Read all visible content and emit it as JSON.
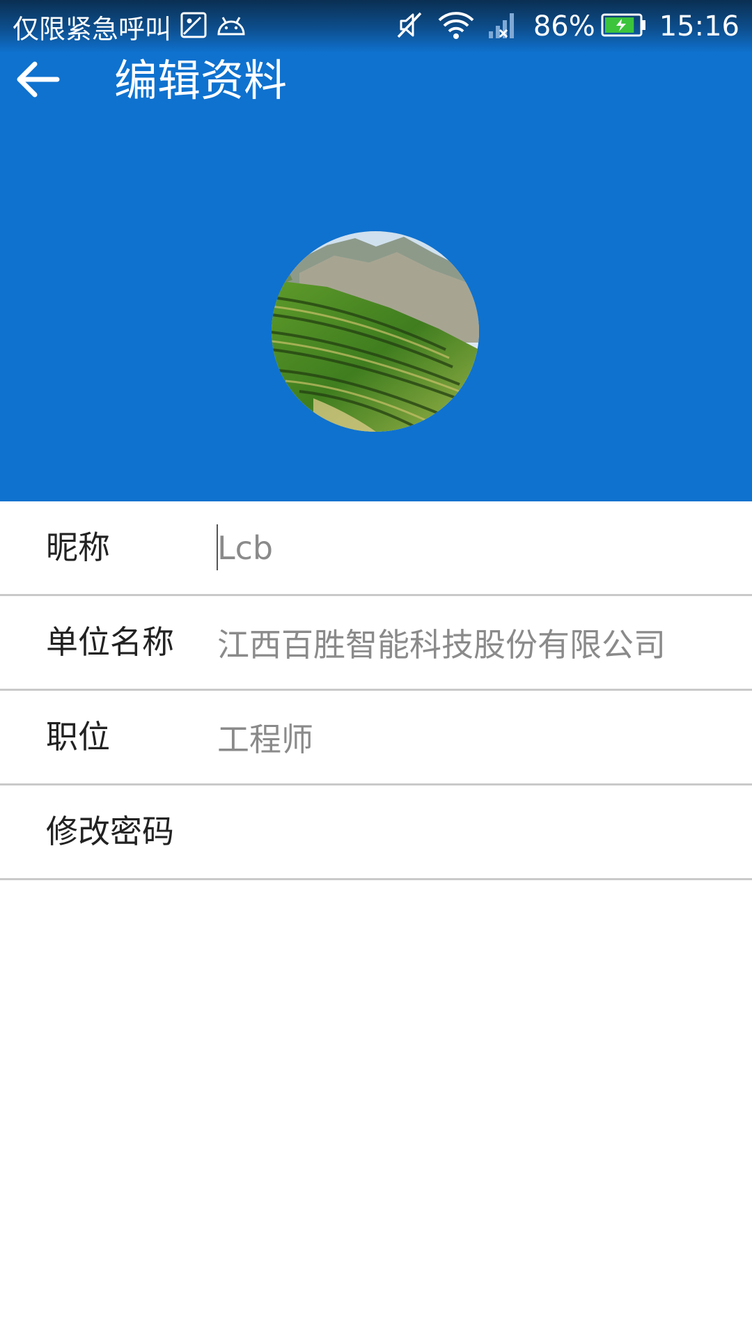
{
  "status_bar": {
    "carrier": "仅限紧急呼叫",
    "battery": "86%",
    "time": "15:16",
    "icons": [
      "gallery-icon",
      "android-icon",
      "mute-icon",
      "wifi-icon",
      "signal-icon",
      "battery-icon"
    ]
  },
  "toolbar": {
    "title": "编辑资料",
    "back_icon": "arrow-left-icon"
  },
  "colors": {
    "header": "#0f72cf",
    "label": "#222222",
    "value": "#8a8a8a",
    "divider": "#c9c9c9",
    "battery_fill": "#3cc43c"
  },
  "profile": {
    "battery_level": 0.86,
    "fields": [
      {
        "label": "昵称",
        "value": "Lcb"
      },
      {
        "label": "单位名称",
        "value": "江西百胜智能科技股份有限公司"
      },
      {
        "label": "职位",
        "value": "工程师"
      }
    ],
    "change_password": {
      "label": "修改密码"
    }
  }
}
